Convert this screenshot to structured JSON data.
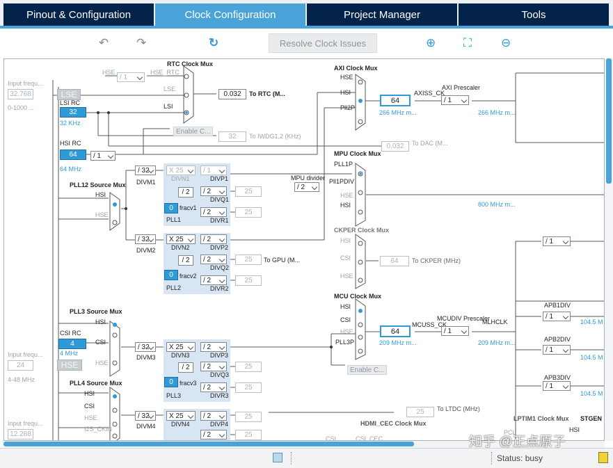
{
  "tabs": [
    {
      "label": "Pinout & Configuration",
      "active": false
    },
    {
      "label": "Clock Configuration",
      "active": true
    },
    {
      "label": "Project Manager",
      "active": false
    },
    {
      "label": "Tools",
      "active": false
    }
  ],
  "toolbar": {
    "undo_icon": "undo-icon",
    "redo_icon": "redo-icon",
    "refresh_icon": "refresh-icon",
    "resolve_label": "Resolve Clock Issues",
    "zoom_in_icon": "zoom-in-icon",
    "fit_icon": "fit-screen-icon",
    "zoom_out_icon": "zoom-out-icon"
  },
  "left": {
    "input_freq_label": "Input frequ...",
    "lse_value": "32.768",
    "lse_range": "0-1000 ...",
    "lse_label": "LSE",
    "lsi_rc_label": "LSI RC",
    "lsi_value": "32",
    "lsi_freq": "32 KHz",
    "hsi_rc_label": "HSI RC",
    "hsi_value": "64",
    "hsi_freq": "64 MHz",
    "csi_rc_label": "CSI RC",
    "csi_value": "4",
    "csi_freq": "4 MHz",
    "hse_value": "24",
    "hse_label": "HSE",
    "hse_range": "4-48 MHz",
    "input_freq_label2": "Input frequ...",
    "input_freq_label3": "Input frequ...",
    "i2s_value": "12.288"
  },
  "rtc": {
    "title": "RTC Clock Mux",
    "hse_in": "HSE",
    "hse_div": "/ 1",
    "hse_rtc": "HSE_RTC",
    "lse_in": "LSE",
    "lsi_in": "LSI",
    "out_value": "0.032",
    "out_label": "To RTC (M...",
    "enable": "Enable C...",
    "iwdg_value": "32",
    "iwdg_label": "To IWDG1,2 (KHz)",
    "dac_value": "0.032",
    "dac_label": "To DAC (M..."
  },
  "hsi_div": "/ 1",
  "pll12": {
    "title": "PLL12 Source Mux",
    "hsi": "HSI",
    "hse": "HSE",
    "divm1": "/ 32",
    "divm1_label": "DIVM1",
    "divm2": "/ 32",
    "divm2_label": "DIVM2",
    "divn1": "X 25",
    "divn1_label": "DIVN1",
    "div2": "/ 2",
    "fracv1": "0",
    "fracv1_label": "fracv1",
    "pll1_label": "PLL1",
    "divp1": "/ 1",
    "divp1_label": "DIVP1",
    "divq1": "/ 2",
    "divq1_label": "DIVQ1",
    "divq1_out": "25",
    "divr1": "/ 2",
    "divr1_label": "DIVR1",
    "divr1_out": "25",
    "divn2": "X 25",
    "divn2_label": "DIVN2",
    "div2b": "/ 2",
    "fracv2": "0",
    "fracv2_label": "fracv2",
    "pll2_label": "PLL2",
    "divp2": "/ 2",
    "divp2_label": "DIVP2",
    "divq2": "/ 2",
    "divq2_label": "DIVQ2",
    "divq2_out": "25",
    "gpu_label": "To GPU (M...",
    "divr2": "/ 2",
    "divr2_label": "DIVR2",
    "divr2_out": "25"
  },
  "axi": {
    "title": "AXI Clock Mux",
    "hse": "HSE",
    "hsi": "HSI",
    "pll2p": "Pll2P",
    "value": "64",
    "freq": "266 MHz m...",
    "axiss": "AXISS_CK",
    "prescaler_label": "AXI Prescaler",
    "prescaler": "/ 1",
    "out": "266 MHz m..."
  },
  "mpu": {
    "title": "MPU Clock Mux",
    "pll1p": "PLL1P",
    "mpu_div_label": "MPU divider",
    "mpu_div": "/ 2",
    "pll1pdiv": "Pll1PDIV",
    "hse": "HSE",
    "hsi": "HSI",
    "out": "800 MHz m..."
  },
  "ckper": {
    "title": "CKPER Clock Mux",
    "hsi": "HSI",
    "csi": "CSI",
    "hse": "HSE",
    "value": "64",
    "label": "To CKPER (MHz)"
  },
  "mcu": {
    "title": "MCU Clock Mux",
    "hsi": "HSI",
    "csi": "CSI",
    "hse": "HSE",
    "pll3p": "PLL3P",
    "value": "64",
    "freq": "209 MHz m...",
    "mcuss": "MCUSS_CK",
    "prescaler_label": "MCUDIV Prescaler",
    "prescaler": "/ 1",
    "mlhclk": "MLHCLK",
    "out": "209 MHz m...",
    "enable": "Enable C..."
  },
  "apb": {
    "top_div": "/ 1",
    "div_a": "/ 1",
    "apb1_label": "APB1DIV",
    "apb1": "/ 1",
    "apb1_out": "104.5 M",
    "apb1_out2": "104.5 M",
    "apb2_label": "APB2DIV",
    "apb2": "/ 1",
    "apb2_out": "104.5 M",
    "apb3_label": "APB3DIV",
    "apb3": "/ 1",
    "apb3_out": "104.5 M"
  },
  "pll3": {
    "title": "PLL3 Source Mux",
    "hsi": "HSI",
    "csi": "CSI",
    "hse": "HSE",
    "divm3": "/ 32",
    "divm3_label": "DIVM3",
    "divn3": "X 25",
    "divn3_label": "DIVN3",
    "div2": "/ 2",
    "fracv3": "0",
    "fracv3_label": "fracv3",
    "pll3_label": "PLL3",
    "divp3": "/ 2",
    "divp3_label": "DIVP3",
    "divq3": "/ 2",
    "divq3_label": "DIVQ3",
    "divq3_out": "25",
    "divr3": "/ 2",
    "divr3_label": "DIVR3",
    "divr3_out": "25"
  },
  "pll4": {
    "title": "PLL4 Source Mux",
    "hsi": "HSI",
    "csi": "CSI",
    "hse": "HSE",
    "i2s": "I2S_CKIN",
    "divm4": "/ 32",
    "divm4_label": "DIVM4",
    "divn4": "X 25",
    "divn4_label": "DIVN4",
    "divp4": "/ 2",
    "divp4_label": "DIVP4",
    "divp4_out": "25",
    "divq4": "/ 2",
    "divq4_out": "25"
  },
  "bottom": {
    "ltdc_value": "25",
    "ltdc_label": "To LTDC (MHz)",
    "hdmi_title": "HDMI_CEC Clock Mux",
    "csi_label": "CSI",
    "csi_cec": "CSI_CEC",
    "lptim_title": "LPTIM1 Clock Mux",
    "pcl": "PCL",
    "hsi_lptim": "HSI",
    "stgen": "STGEN"
  },
  "status": {
    "text": "Status: busy"
  },
  "watermark": "知乎 @正点原子"
}
